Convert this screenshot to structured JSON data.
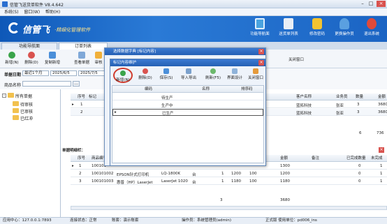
{
  "app": {
    "title": "信管飞送货单软件 V8.4.642",
    "menu": [
      "系统(S)",
      "窗口(W)",
      "帮助(H)"
    ],
    "logo_text": "信管飞",
    "slogan": "·精细化管理软件"
  },
  "banner_buttons": [
    {
      "label": "功能导航面",
      "color": "#4aa3df"
    },
    {
      "label": "送货单列表",
      "color": "#e8eef6"
    },
    {
      "label": "修改密码",
      "color": "#f2c330"
    },
    {
      "label": "更换操作员",
      "color": "#5aa0e0"
    },
    {
      "label": "退出系统",
      "color": "#e04a3a"
    }
  ],
  "tabs": [
    "功能导航面",
    "订单列表"
  ],
  "toolbar": [
    "新增(N)",
    "删除(D)",
    "复制新增",
    "查看单据",
    "审核"
  ],
  "close_window_label": "关闭窗口",
  "filter": {
    "date_label": "单据日期",
    "range": "最近1个月",
    "from": "2025/6/5",
    "to": "2025/7/5",
    "item_label": "商品名称"
  },
  "tree": {
    "root": "所有单据",
    "items": [
      "待审核",
      "已审核",
      "已红冲"
    ]
  },
  "order_grid": {
    "headers": [
      "序号",
      "标记"
    ],
    "right_headers": [
      "客户名称",
      "业务员",
      "数量",
      "金额"
    ],
    "rows": [
      {
        "no": "1",
        "customer": "蓝拓科技",
        "staff": "张亚",
        "qty": "3",
        "amount": "3680"
      },
      {
        "no": "2",
        "customer": "蓝拓科技",
        "staff": "张亚",
        "qty": "3",
        "amount": "3680"
      }
    ],
    "total_qty": "6",
    "total_amount": "736"
  },
  "detail": {
    "label": "单据明细栏：",
    "headers": [
      "序号",
      "商品编号",
      "",
      "",
      "",
      "",
      "",
      "",
      "金额",
      "备注",
      "已完成数量",
      "未完成"
    ],
    "rows": [
      {
        "no": "1",
        "code": "100101",
        "name": "",
        "model": "",
        "unit": "",
        "qty": "",
        "price": "",
        "disc": "",
        "amount": "1300",
        "done": "0",
        "undone": "1"
      },
      {
        "no": "2",
        "code": "100101002",
        "name": "EPSON针式打印机",
        "model": "LQ-1800K",
        "unit": "台",
        "qty": "1",
        "price": "1200",
        "disc": "100",
        "amount": "1200",
        "done": "0",
        "undone": "1"
      },
      {
        "no": "3",
        "code": "100101003",
        "name": "惠普（HP）LaserJet",
        "model": "LaserJet 1020",
        "unit": "台",
        "qty": "1",
        "price": "1180",
        "disc": "100",
        "amount": "1180",
        "done": "0",
        "undone": "1"
      }
    ],
    "total_qty": "3",
    "total_amount": "3680"
  },
  "dialog_outer": {
    "title": "选择数据字典 [标记内容]"
  },
  "dialog_inner": {
    "title": "标记内容维护",
    "toolbar": [
      "新增(N)",
      "删除(D)",
      "保存(S)",
      "导入导出",
      "刷新(F5)",
      "界面设计",
      "关闭窗口"
    ],
    "headers": [
      "编码",
      "名称",
      "排序码"
    ],
    "rows": [
      {
        "code": "",
        "name": "待生产",
        "sort": ""
      },
      {
        "code": "",
        "name": "生产中",
        "sort": ""
      },
      {
        "code": "",
        "name": "已生产",
        "sort": ""
      }
    ]
  },
  "status": {
    "center": "应用中心：127.0.0.1:7893",
    "conn": "连接状态：正常",
    "account": "账套：演示账套",
    "operator": "操作员：系统管理员(admin)",
    "version": "正式版 使用单位：pd006_ins"
  }
}
